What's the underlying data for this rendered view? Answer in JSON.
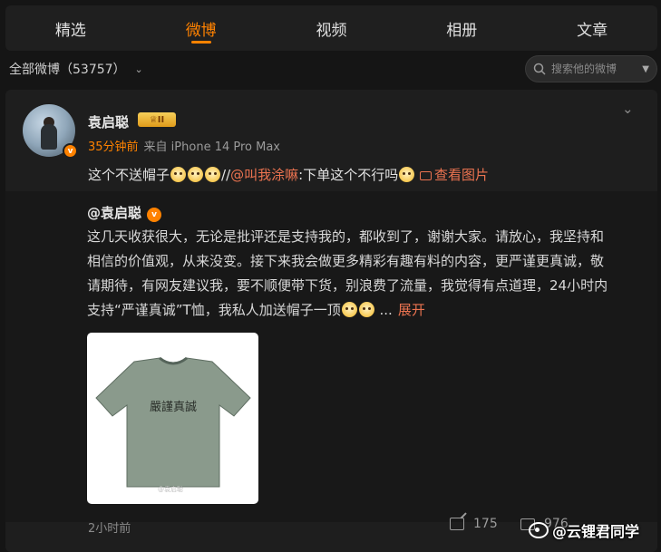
{
  "tabs": [
    {
      "label": "精选",
      "active": false
    },
    {
      "label": "微博",
      "active": true
    },
    {
      "label": "视频",
      "active": false
    },
    {
      "label": "相册",
      "active": false
    },
    {
      "label": "文章",
      "active": false
    }
  ],
  "filter": {
    "label": "全部微博（53757）"
  },
  "search": {
    "placeholder": "搜索他的微博"
  },
  "post": {
    "author": "袁启聪",
    "level_badge": "II",
    "verified_mark": "v",
    "time": "35分钟前",
    "source": "来自 iPhone 14 Pro Max",
    "text_before": "这个不送帽子",
    "text_sep": "//",
    "mention": "@叫我涂嘛",
    "text_after": ":下单这个不行吗",
    "view_image": "查看图片"
  },
  "repost": {
    "author": "@袁启聪",
    "verified_mark": "v",
    "lines": [
      "这几天收获很大，无论是批评还是支持我的，都收到了，谢谢大家。请放心，我坚持和",
      "相信的价值观，从来没变。接下来我会做更多精彩有趣有料的内容，更严谨更真诚，敬",
      "请期待，有网友建议我，要不顺便带下货，别浪费了流量，我觉得有点道理，24小时内"
    ],
    "last_line": "支持“严谨真诚”T恤，我私人加送帽子一顶",
    "ellipsis": "...",
    "expand": "展开",
    "tshirt_text": "嚴謹真誠",
    "image_watermark": "@袁启聪",
    "time": "2小时前"
  },
  "actions": {
    "share_count": "175",
    "comment_count": "976"
  },
  "watermark": "@云锂君同学",
  "colors": {
    "accent": "#ff8200",
    "link": "#eb7350",
    "shirt": "#8a9a8c"
  }
}
